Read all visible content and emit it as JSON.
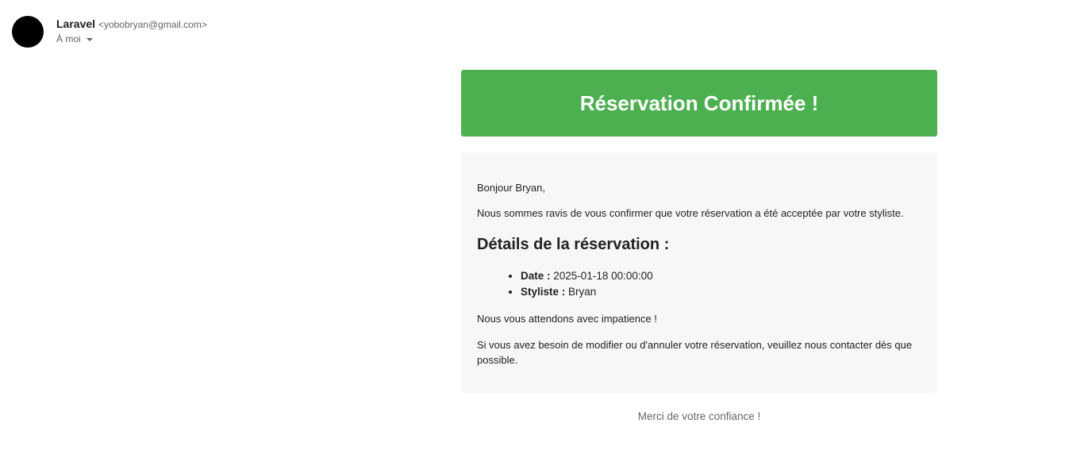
{
  "header": {
    "sender_name": "Laravel",
    "sender_email": "<yobobryan@gmail.com>",
    "recipient": "À moi"
  },
  "email": {
    "banner_title": "Réservation Confirmée !",
    "greeting": "Bonjour Bryan,",
    "intro": "Nous sommes ravis de vous confirmer que votre réservation a été acceptée par votre styliste.",
    "details_title": "Détails de la réservation :",
    "details": [
      {
        "label": "Date :",
        "value": "2025-01-18 00:00:00"
      },
      {
        "label": "Styliste :",
        "value": "Bryan"
      }
    ],
    "waiting": "Nous vous attendons avec impatience !",
    "contact": "Si vous avez besoin de modifier ou d'annuler votre réservation, veuillez nous contacter dès que possible.",
    "footer": "Merci de votre confiance !"
  },
  "colors": {
    "banner": "#4caf50",
    "content_background": "#f7f7f7",
    "avatar": "#000000"
  },
  "icons": {
    "recipient_toggle": "chevron-down-icon"
  }
}
